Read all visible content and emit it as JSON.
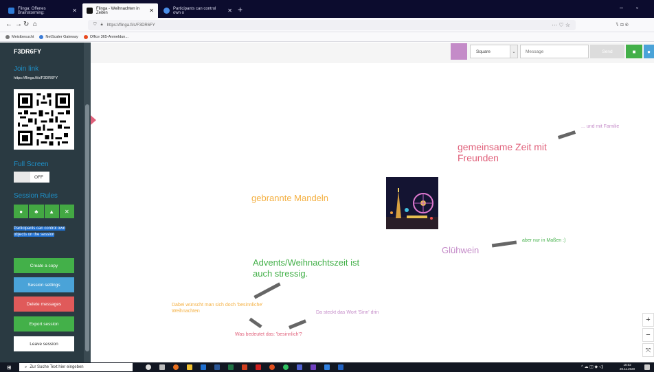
{
  "browser": {
    "tabs": [
      {
        "title": "Flinga: Offenes Brainstorming:",
        "active": false,
        "favicon_color": "#2e7bd6"
      },
      {
        "title": "Flinga - Weihnachten in Zeiten",
        "active": true,
        "favicon_color": "#111111"
      },
      {
        "title": "Participants can control own o",
        "active": false,
        "favicon_color": "#4a8ee8"
      }
    ],
    "new_tab": "+",
    "url": "https://flinga.fi/s/F3DR6FY",
    "url_actions": "··· ♡ ☆",
    "nav_right": "⑊ ◫ ◉",
    "bookmarks": [
      {
        "label": "Meistbesucht",
        "color": "#777777"
      },
      {
        "label": "NetScaler Gateway",
        "color": "#3b7bd6"
      },
      {
        "label": "Office 365-Anmeldun...",
        "color": "#e8491e"
      }
    ]
  },
  "sidebar": {
    "session_id": "F3DR6FY",
    "join_heading": "Join link",
    "join_url": "https://flinga.fi/s/F3DR6FY",
    "fullscreen_heading": "Full Screen",
    "fullscreen_state": "OFF",
    "rules_heading": "Session Rules",
    "rules_icons": [
      "●",
      "♣",
      "▲",
      "✕"
    ],
    "rules_description": "Participants can control own objects on the session",
    "buttons": {
      "create_copy": "Create a copy",
      "session_settings": "Session settings",
      "delete_messages": "Delete messages",
      "export_session": "Export session",
      "leave_session": "Leave session"
    }
  },
  "toolbar": {
    "color": "#c48bc8",
    "shape": "Square",
    "message_placeholder": "Message",
    "send_label": "Send",
    "camera_icon": "■",
    "info_icon": "●"
  },
  "notes": [
    {
      "id": "gemeinsame",
      "text": "gemeinsame Zeit mit\nFreunden",
      "color": "#e0607a"
    },
    {
      "id": "familie",
      "text": "... und mit Familie",
      "color": "#c48bc8"
    },
    {
      "id": "mandeln",
      "text": "gebrannte Mandeln",
      "color": "#f4b042"
    },
    {
      "id": "gluehwein",
      "text": "Glühwein",
      "color": "#c48bc8"
    },
    {
      "id": "massen",
      "text": "aber nur in Maßen :)",
      "color": "#43b049"
    },
    {
      "id": "advent",
      "text": "Advents/Weihnachtszeit ist\nauch stressig.",
      "color": "#43b049"
    },
    {
      "id": "besinnlich",
      "text": "Dabei wünscht man sich doch 'besinnliche'\nWeihnachten",
      "color": "#f4b042"
    },
    {
      "id": "sinn",
      "text": "Da steckt das Wort 'Sinn' drin",
      "color": "#c48bc8"
    },
    {
      "id": "frage",
      "text": "Was bedeutet das: 'besinnlich'?",
      "color": "#e0607a"
    }
  ],
  "zoom": {
    "in": "+",
    "out": "−",
    "fit": "⤧"
  },
  "taskbar": {
    "start_icon": "⊞",
    "search_placeholder": "Zur Suche Text hier eingeben",
    "tray_icons": "^ ☁ ◫ ◆ ◁)",
    "time": "10:02",
    "date": "20.11.2020"
  }
}
